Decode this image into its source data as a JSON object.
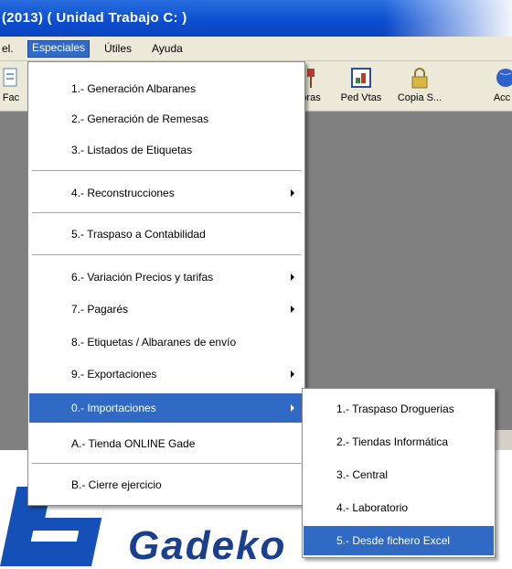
{
  "window": {
    "title": "(2013) ( Unidad Trabajo C: )"
  },
  "menubar": {
    "items": [
      {
        "label": "el."
      },
      {
        "label": "Especiales"
      },
      {
        "label": "Útiles"
      },
      {
        "label": "Ayuda"
      }
    ]
  },
  "toolbar": {
    "buttons": [
      {
        "label": "Fac",
        "icon": "document-icon"
      },
      {
        "label": "bras",
        "icon": "purchases-icon"
      },
      {
        "label": "Ped Vtas",
        "icon": "sales-order-icon"
      },
      {
        "label": "Copia S...",
        "icon": "backup-lock-icon"
      },
      {
        "label": "Acc",
        "icon": "globe-icon"
      }
    ]
  },
  "especiales_menu": {
    "items": [
      {
        "label": "1.- Generación Albaranes"
      },
      {
        "label": "2.- Generación de Remesas"
      },
      {
        "label": "3.- Listados de Etiquetas"
      },
      {
        "label": "4.- Reconstrucciones"
      },
      {
        "label": "5.- Traspaso a Contabilidad"
      },
      {
        "label": "6.- Variación Precios y tarifas"
      },
      {
        "label": "7.- Pagarés"
      },
      {
        "label": "8.- Etiquetas / Albaranes de envío"
      },
      {
        "label": "9.- Exportaciones"
      },
      {
        "label": "0.- Importaciones"
      },
      {
        "label": "A.- Tienda ONLINE Gade"
      },
      {
        "label": "B.- Cierre ejercicio"
      }
    ]
  },
  "importaciones_submenu": {
    "items": [
      {
        "label": "1.- Traspaso Droguerias"
      },
      {
        "label": "2.- Tiendas Informática"
      },
      {
        "label": "3.- Central"
      },
      {
        "label": "4.- Laboratorio"
      },
      {
        "label": "5.- Desde fichero Excel"
      }
    ]
  },
  "logo": {
    "text": "Gadeko"
  },
  "colors": {
    "title_bar": "#0c4fd0",
    "selection": "#316ac5",
    "workspace": "#808080",
    "logo_blue": "#1550b8"
  }
}
